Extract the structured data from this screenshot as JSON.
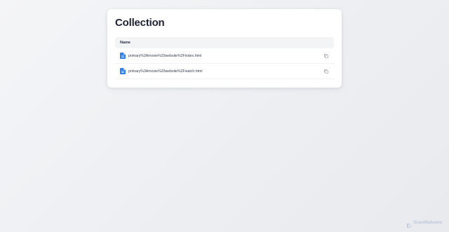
{
  "page": {
    "title": "Collection"
  },
  "table": {
    "header": "Name",
    "rows": [
      {
        "name": "primary%3Amovie%20website%2Findex.html",
        "icon": "file-icon",
        "action_icon": "copy-icon"
      },
      {
        "name": "primary%3Amovie%20website%2Fwatch.html",
        "icon": "file-icon",
        "action_icon": "copy-icon"
      }
    ]
  },
  "watermark": {
    "text": "ScanMalware",
    "icon": "scanmalware-logo-icon"
  },
  "colors": {
    "file_icon": "#2f80ed",
    "title": "#1c2333",
    "header_bg": "#f3f4f6",
    "watermark": "#9aaccc"
  }
}
